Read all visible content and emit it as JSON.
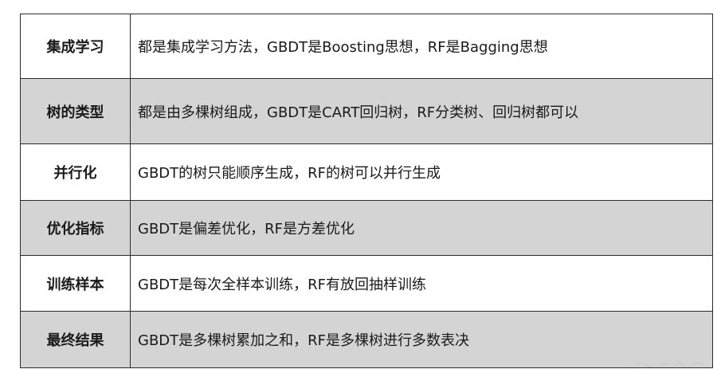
{
  "rows": [
    {
      "label": "集成学习",
      "text": "都是集成学习方法，GBDT是Boosting思想，RF是Bagging思想",
      "shaded": false
    },
    {
      "label": "树的类型",
      "text": "都是由多棵树组成，GBDT是CART回归树，RF分类树、回归树都可以",
      "shaded": true
    },
    {
      "label": "并行化",
      "text": "GBDT的树只能顺序生成，RF的树可以并行生成",
      "shaded": false
    },
    {
      "label": "优化指标",
      "text": "GBDT是偏差优化，RF是方差优化",
      "shaded": true
    },
    {
      "label": "训练样本",
      "text": "GBDT是每次全样本训练，RF有放回抽样训练",
      "shaded": false
    },
    {
      "label": "最终结果",
      "text": "GBDT是多棵树累加之和，RF是多棵树进行多数表决",
      "shaded": true
    }
  ],
  "colors": {
    "shade": "#d4d4d4",
    "border": "#2b2b2b",
    "text": "#1a1a1a"
  }
}
